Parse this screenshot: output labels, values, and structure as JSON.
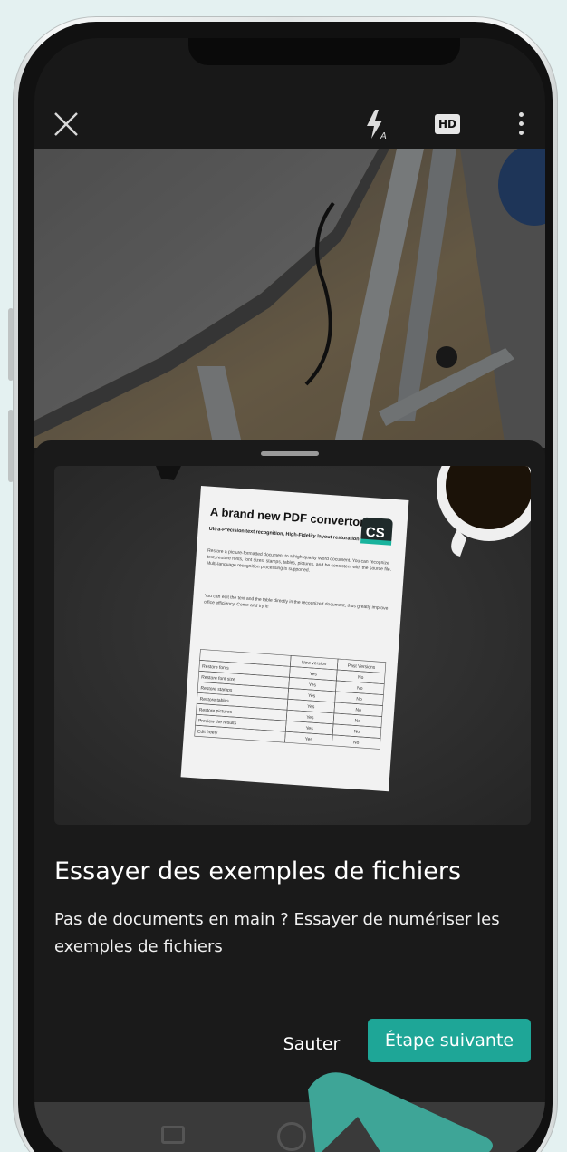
{
  "toolbar": {
    "close_icon": "close-icon",
    "flash_icon": "flash-auto-icon",
    "flash_sub": "A",
    "hd_label": "HD",
    "more_icon": "more-vertical-icon"
  },
  "sample_document": {
    "title": "A brand new PDF convertor",
    "subtitle": "Ultra-Precision text recognition, High-Fidelity layout restoration",
    "logo": "CS",
    "paragraph1": "Restore a picture-formatted document to a high-quality Word document. You can recognize text, restore fonts, font sizes, stamps, tables, pictures, and be consistent with the source file. Multi-language recognition processing is supported.",
    "paragraph2": "You can edit the text and the table directly in the recognized document, thus greatly improve office efficiency. Come and try it!",
    "table": {
      "headers": [
        "",
        "New version",
        "Past Versions"
      ],
      "rows": [
        [
          "Restore fonts",
          "Yes",
          "No"
        ],
        [
          "Restore font size",
          "Yes",
          "No"
        ],
        [
          "Restore stamps",
          "Yes",
          "No"
        ],
        [
          "Restore tables",
          "Yes",
          "No"
        ],
        [
          "Restore pictures",
          "Yes",
          "No"
        ],
        [
          "Preview the results",
          "Yes",
          "No"
        ],
        [
          "Edit freely",
          "Yes",
          "No"
        ]
      ]
    }
  },
  "sheet": {
    "title": "Essayer des exemples de fichiers",
    "description": "Pas de documents en main ? Essayer de numériser les exemples de fichiers",
    "skip_label": "Sauter",
    "next_label": "Étape suivante"
  },
  "colors": {
    "accent": "#1ea697",
    "background": "#e4f1f1",
    "sheet": "#1a1a1a"
  }
}
